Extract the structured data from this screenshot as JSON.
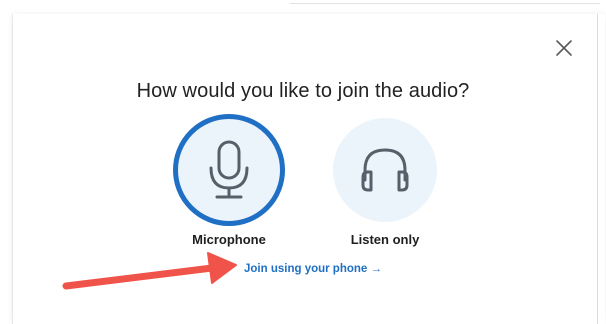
{
  "dialog": {
    "title": "How would you like to join the audio?",
    "options": [
      {
        "label": "Microphone",
        "icon": "microphone-icon",
        "selected": true
      },
      {
        "label": "Listen only",
        "icon": "headphones-icon",
        "selected": false
      }
    ],
    "phone_link": "Join using your phone →",
    "close_icon": "close-icon"
  },
  "colors": {
    "accent": "#1f6fc4",
    "option_background": "#ecf4fb",
    "icon_stroke": "#56606a",
    "annotation_arrow": "#f0534a"
  }
}
